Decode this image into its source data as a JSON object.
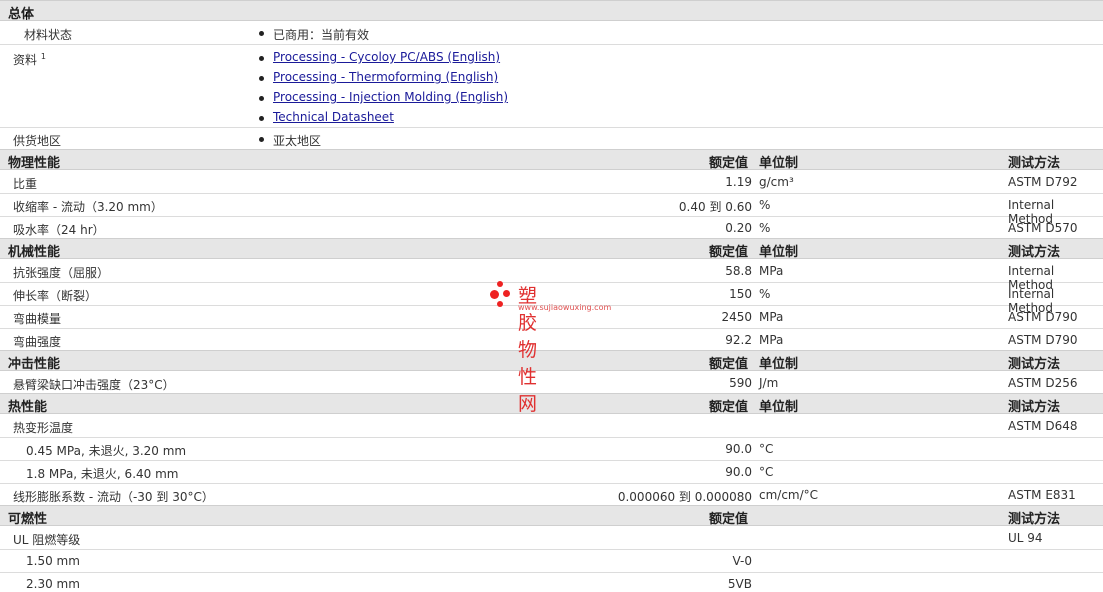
{
  "general": {
    "title": "总体",
    "status_label": "材料状态",
    "status_value": "已商用：当前有效",
    "docs_label": "资料",
    "docs_sup": "1",
    "links": [
      "Processing - Cycoloy PC/ABS (English)",
      "Processing - Thermoforming (English)",
      "Processing - Injection Molding (English)",
      "Technical Datasheet"
    ],
    "region_label": "供货地区",
    "region_value": "亚太地区"
  },
  "headers": {
    "rated": "额定值",
    "unit": "单位制",
    "method": "测试方法"
  },
  "physical": {
    "title": "物理性能",
    "rows": [
      {
        "label": "比重",
        "value": "1.19",
        "unit": "g/cm³",
        "method": "ASTM D792"
      },
      {
        "label": "收缩率 - 流动（3.20 mm）",
        "value": "0.40 到  0.60",
        "unit": "%",
        "method": "Internal Method"
      },
      {
        "label": "吸水率（24 hr）",
        "value": "0.20",
        "unit": "%",
        "method": "ASTM D570"
      }
    ]
  },
  "mechanical": {
    "title": "机械性能",
    "rows": [
      {
        "label": "抗张强度（屈服）",
        "value": "58.8",
        "unit": "MPa",
        "method": "Internal Method"
      },
      {
        "label": "伸长率（断裂）",
        "value": "150",
        "unit": "%",
        "method": "Internal Method"
      },
      {
        "label": "弯曲模量",
        "value": "2450",
        "unit": "MPa",
        "method": "ASTM D790"
      },
      {
        "label": "弯曲强度",
        "value": "92.2",
        "unit": "MPa",
        "method": "ASTM D790"
      }
    ]
  },
  "impact": {
    "title": "冲击性能",
    "rows": [
      {
        "label": "悬臂梁缺口冲击强度（23°C）",
        "value": "590",
        "unit": "J/m",
        "method": "ASTM D256"
      }
    ]
  },
  "thermal": {
    "title": "热性能",
    "rows": [
      {
        "label": "热变形温度",
        "value": "",
        "unit": "",
        "method": "ASTM D648"
      },
      {
        "label": "0.45 MPa, 未退火, 3.20 mm",
        "value": "90.0",
        "unit": "°C",
        "method": ""
      },
      {
        "label": "1.8 MPa, 未退火, 6.40 mm",
        "value": "90.0",
        "unit": "°C",
        "method": ""
      },
      {
        "label": "线形膨胀系数 - 流动（-30 到  30°C）",
        "value": "0.000060 到  0.000080",
        "unit": "cm/cm/°C",
        "method": "ASTM E831"
      }
    ]
  },
  "flammability": {
    "title": "可燃性",
    "rows": [
      {
        "label": "UL 阻燃等级",
        "value": "",
        "unit": "",
        "method": "UL 94"
      },
      {
        "label": "1.50 mm",
        "value": "V-0",
        "unit": "",
        "method": ""
      },
      {
        "label": "2.30 mm",
        "value": "5VB",
        "unit": "",
        "method": ""
      }
    ]
  },
  "watermark": {
    "name": "塑胶物性网",
    "url": "www.sujiaowuxing.com",
    "color": "#e03030"
  }
}
